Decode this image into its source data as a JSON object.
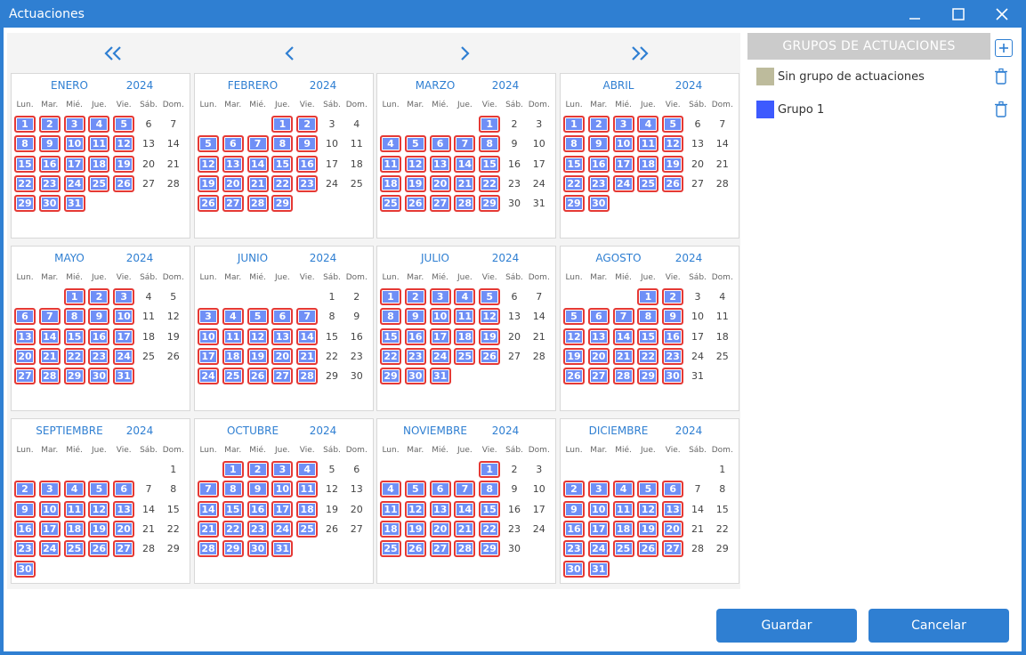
{
  "window": {
    "title": "Actuaciones"
  },
  "weekdays": [
    "Lun.",
    "Mar.",
    "Mié.",
    "Jue.",
    "Vie.",
    "Sáb.",
    "Dom."
  ],
  "months": [
    {
      "name": "ENERO",
      "year": "2024",
      "offset": 0,
      "days": 31,
      "selected": [
        1,
        2,
        3,
        4,
        5,
        8,
        9,
        10,
        11,
        12,
        15,
        16,
        17,
        18,
        19,
        22,
        23,
        24,
        25,
        26,
        29,
        30,
        31
      ]
    },
    {
      "name": "FEBRERO",
      "year": "2024",
      "offset": 3,
      "days": 29,
      "selected": [
        1,
        2,
        5,
        6,
        7,
        8,
        9,
        12,
        13,
        14,
        15,
        16,
        19,
        20,
        21,
        22,
        23,
        26,
        27,
        28,
        29
      ]
    },
    {
      "name": "MARZO",
      "year": "2024",
      "offset": 4,
      "days": 31,
      "selected": [
        1,
        4,
        5,
        6,
        7,
        8,
        11,
        12,
        13,
        14,
        15,
        18,
        19,
        20,
        21,
        22,
        25,
        26,
        27,
        28,
        29
      ]
    },
    {
      "name": "ABRIL",
      "year": "2024",
      "offset": 0,
      "days": 30,
      "selected": [
        1,
        2,
        3,
        4,
        5,
        8,
        9,
        10,
        11,
        12,
        15,
        16,
        17,
        18,
        19,
        22,
        23,
        24,
        25,
        26,
        29,
        30
      ]
    },
    {
      "name": "MAYO",
      "year": "2024",
      "offset": 2,
      "days": 31,
      "selected": [
        1,
        2,
        3,
        6,
        7,
        8,
        9,
        10,
        13,
        14,
        15,
        16,
        17,
        20,
        21,
        22,
        23,
        24,
        27,
        28,
        29,
        30,
        31
      ]
    },
    {
      "name": "JUNIO",
      "year": "2024",
      "offset": 5,
      "days": 30,
      "selected": [
        3,
        4,
        5,
        6,
        7,
        10,
        11,
        12,
        13,
        14,
        17,
        18,
        19,
        20,
        21,
        24,
        25,
        26,
        27,
        28
      ]
    },
    {
      "name": "JULIO",
      "year": "2024",
      "offset": 0,
      "days": 31,
      "selected": [
        1,
        2,
        3,
        4,
        5,
        8,
        9,
        10,
        11,
        12,
        15,
        16,
        17,
        18,
        19,
        22,
        23,
        24,
        25,
        26,
        29,
        30,
        31
      ]
    },
    {
      "name": "AGOSTO",
      "year": "2024",
      "offset": 3,
      "days": 31,
      "selected": [
        1,
        2,
        5,
        6,
        7,
        8,
        9,
        12,
        13,
        14,
        15,
        16,
        19,
        20,
        21,
        22,
        23,
        26,
        27,
        28,
        29,
        30
      ]
    },
    {
      "name": "SEPTIEMBRE",
      "year": "2024",
      "offset": 6,
      "days": 30,
      "selected": [
        2,
        3,
        4,
        5,
        6,
        9,
        10,
        11,
        12,
        13,
        16,
        17,
        18,
        19,
        20,
        23,
        24,
        25,
        26,
        27,
        30
      ]
    },
    {
      "name": "OCTUBRE",
      "year": "2024",
      "offset": 1,
      "days": 31,
      "selected": [
        1,
        2,
        3,
        4,
        7,
        8,
        9,
        10,
        11,
        14,
        15,
        16,
        17,
        18,
        21,
        22,
        23,
        24,
        25,
        28,
        29,
        30,
        31
      ]
    },
    {
      "name": "NOVIEMBRE",
      "year": "2024",
      "offset": 4,
      "days": 30,
      "selected": [
        1,
        4,
        5,
        6,
        7,
        8,
        11,
        12,
        13,
        14,
        15,
        18,
        19,
        20,
        21,
        22,
        25,
        26,
        27,
        28,
        29
      ]
    },
    {
      "name": "DICIEMBRE",
      "year": "2024",
      "offset": 6,
      "days": 31,
      "selected": [
        2,
        3,
        4,
        5,
        6,
        9,
        10,
        11,
        12,
        13,
        16,
        17,
        18,
        19,
        20,
        23,
        24,
        25,
        26,
        27,
        30,
        31
      ]
    }
  ],
  "sidebar": {
    "header": "GRUPOS DE ACTUACIONES",
    "groups": [
      {
        "label": "Sin grupo de actuaciones",
        "color": "#bdbb9c"
      },
      {
        "label": "Grupo 1",
        "color": "#3d5afe"
      }
    ]
  },
  "buttons": {
    "save": "Guardar",
    "cancel": "Cancelar"
  },
  "colors": {
    "accent": "#2f7fd2",
    "selected_fill": "#6f8ff6",
    "selected_border": "#e53935"
  }
}
